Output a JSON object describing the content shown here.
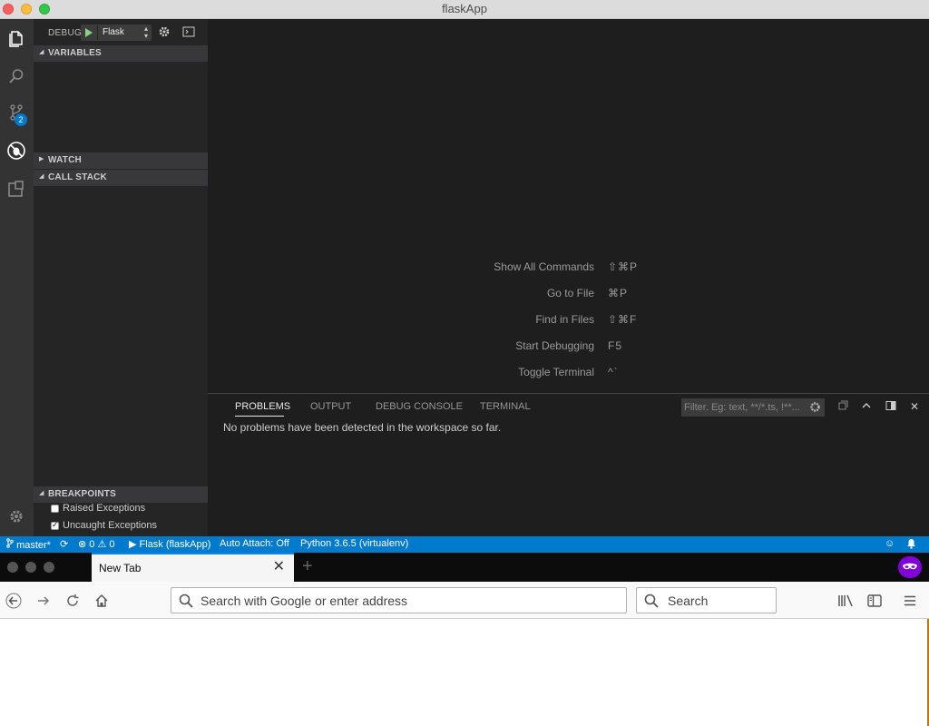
{
  "window": {
    "title": "flaskApp"
  },
  "activity_bar": {
    "source_control_badge": "2"
  },
  "debug": {
    "title": "DEBUG",
    "configuration": "Flask",
    "sections": {
      "variables": "VARIABLES",
      "watch": "WATCH",
      "call_stack": "CALL STACK",
      "breakpoints": "BREAKPOINTS"
    },
    "breakpoints": [
      {
        "label": "Raised Exceptions",
        "checked": false
      },
      {
        "label": "Uncaught Exceptions",
        "checked": true
      }
    ]
  },
  "editor": {
    "hints": [
      {
        "label": "Show All Commands",
        "keys": "⇧⌘P"
      },
      {
        "label": "Go to File",
        "keys": "⌘P"
      },
      {
        "label": "Find in Files",
        "keys": "⇧⌘F"
      },
      {
        "label": "Start Debugging",
        "keys": "F5"
      },
      {
        "label": "Toggle Terminal",
        "keys": "^`"
      }
    ]
  },
  "panel": {
    "tabs": [
      "PROBLEMS",
      "OUTPUT",
      "DEBUG CONSOLE",
      "TERMINAL"
    ],
    "active_tab": "PROBLEMS",
    "filter_placeholder": "Filter. Eg: text, **/*.ts, !**...",
    "message": "No problems have been detected in the workspace so far."
  },
  "statusbar": {
    "branch": "master*",
    "errors": "0",
    "warnings": "0",
    "launch": "Flask (flaskApp)",
    "auto_attach": "Auto Attach: Off",
    "interpreter": "Python 3.6.5 (virtualenv)",
    "color": "#007acc"
  },
  "browser": {
    "tab_label": "New Tab",
    "url_placeholder": "Search with Google or enter address",
    "search_placeholder": "Search",
    "accent": "#0a84ff",
    "private_color": "#8000d7"
  }
}
